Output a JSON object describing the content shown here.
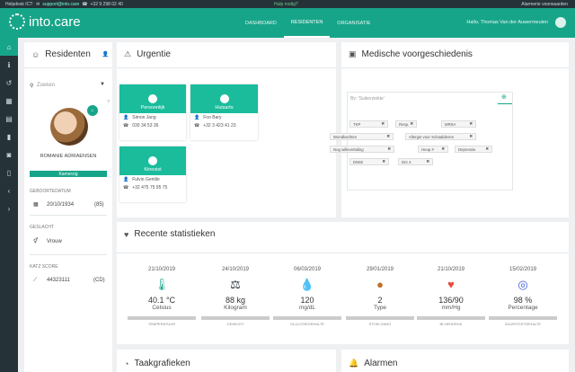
{
  "topbar": {
    "helpdesk": "Helpdesk ICT:",
    "email": "support@into.care",
    "phone": "+32 9 298 02 40",
    "help": "Hulp nodig?",
    "alarm": "Alarmerie voorwaarden"
  },
  "header": {
    "logo": "into.care",
    "nav": [
      "DASHBOARD",
      "RESIDENTEN",
      "ORGANISATIE"
    ],
    "user": "Hallo, Thomas Van der Auwermeulen"
  },
  "residents": {
    "title": "Residenten",
    "search_placeholder": "Zoeken",
    "name": "ROMANIE ADRIAENSEN",
    "room": "Kamerzig",
    "dob_label": "GEBOORTEDATUM",
    "dob": "20/10/1934",
    "age": "(85)",
    "gender_label": "GESLACHT",
    "gender": "Vrouw",
    "katz_label": "KATZ SCORE",
    "katz": "44323111",
    "katz_code": "(CD)"
  },
  "urgentie": {
    "title": "Urgentie",
    "cards": [
      {
        "role": "Persoonlijk",
        "name": "Simon Jang",
        "phone": "030 34 53 36"
      },
      {
        "role": "Huisarts",
        "name": "Foo Bary",
        "phone": "+32 3 423 41 23"
      },
      {
        "role": "Kinesist",
        "name": "Fulvio Gentile",
        "phone": "+32 475 75 95 75"
      }
    ]
  },
  "medisch": {
    "title": "Medische voorgeschiedenis",
    "search_placeholder": "Bv: 'Suikerziekte'",
    "tags": [
      "TKP",
      "Resp.",
      "MRSA",
      "Wondkachten",
      "Allergie voor Schaaldieren",
      "Nog willevertaling",
      "Heup #",
      "Depressie",
      "DN82",
      "Dnr 4"
    ]
  },
  "stats": {
    "title": "Recente statistieken",
    "items": [
      {
        "date": "21/10/2019",
        "icon": "thermometer-icon",
        "glyph": "🌡",
        "value": "40.1 °C",
        "unit": "Celsius",
        "caption": "TEMPERATUUR",
        "color": "#17a589"
      },
      {
        "date": "24/10/2019",
        "icon": "scale-icon",
        "glyph": "⚖",
        "value": "88 kg",
        "unit": "Kilogram",
        "caption": "GEWICHT",
        "color": "#253238"
      },
      {
        "date": "06/03/2019",
        "icon": "blood-drop-icon",
        "glyph": "💧",
        "value": "120",
        "unit": "mg/dL",
        "caption": "GLUCOSEGEHALTE",
        "color": "#e74c3c"
      },
      {
        "date": "29/01/2019",
        "icon": "stool-icon",
        "glyph": "●",
        "value": "2",
        "unit": "Type",
        "caption": "STOELGANG",
        "color": "#c0702c"
      },
      {
        "date": "21/10/2019",
        "icon": "heart-pulse-icon",
        "glyph": "♥",
        "value": "136/90",
        "unit": "mm/Hg",
        "caption": "BLOEDDRUK",
        "color": "#e74c3c"
      },
      {
        "date": "15/02/2019",
        "icon": "target-icon",
        "glyph": "◎",
        "value": "98 %",
        "unit": "Percentage",
        "caption": "ZUURSTOFGEHALTE",
        "color": "#3b5bdb"
      }
    ]
  },
  "bottom": {
    "taak": "Taakgrafieken",
    "alarmen": "Alarmen"
  }
}
